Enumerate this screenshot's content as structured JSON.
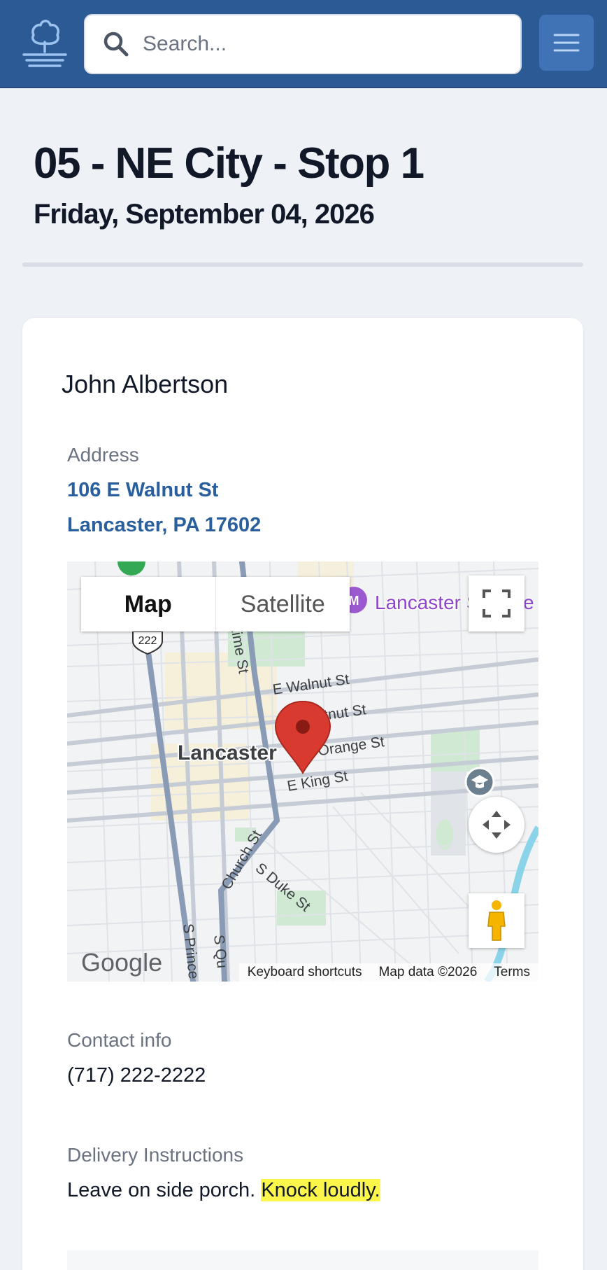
{
  "header": {
    "search_placeholder": "Search..."
  },
  "page": {
    "title": "05 - NE City - Stop 1",
    "date": "Friday, September 04, 2026"
  },
  "stop": {
    "customer_name": "John Albertson",
    "address_label": "Address",
    "address_line1": "106 E Walnut St",
    "address_line2": "Lancaster, PA 17602",
    "contact_label": "Contact info",
    "phone": "(717) 222-2222",
    "instructions_label": "Delivery Instructions",
    "instructions_text": "Leave on side porch. ",
    "instructions_highlight": "Knock loudly."
  },
  "map": {
    "type_map": "Map",
    "type_satellite": "Satellite",
    "city_label": "Lancaster",
    "poi_label": "Lancaster S",
    "poi_suffix": "e",
    "route_shield": "222",
    "streets": {
      "walnut": "E Walnut St",
      "chestnut": "E Chestnut St",
      "orange": "E Orange St",
      "king": "E King St",
      "church": "Church St",
      "duke": "S Duke St",
      "lime": "N Lime St",
      "prince": "S Prince",
      "queen": "S Qu"
    },
    "provider_logo": "Google",
    "footer_shortcuts": "Keyboard shortcuts",
    "footer_data": "Map data ©2026",
    "footer_terms": "Terms"
  },
  "colors": {
    "header_bg": "#2c5a94",
    "link": "#2a5f9e",
    "highlight": "#fdf64a",
    "pin": "#d93a2f",
    "poi": "#8e44c9"
  }
}
